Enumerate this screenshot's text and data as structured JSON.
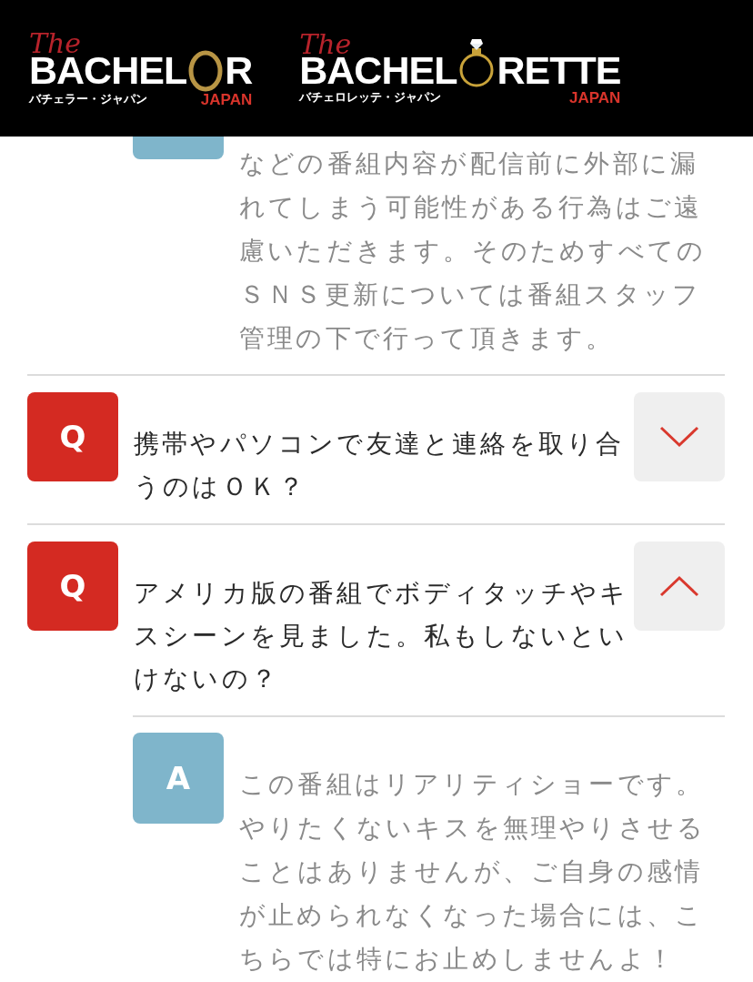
{
  "header": {
    "logos": [
      {
        "script": "The",
        "word_start": "BACHEL",
        "word_end": "R",
        "subtitle": "バチェラー・ジャパン",
        "region": "JAPAN"
      },
      {
        "script": "The",
        "word_start": "BACHEL",
        "word_end": "RETTE",
        "subtitle": "バチェロレッテ・ジャパン",
        "region": "JAPAN"
      }
    ]
  },
  "partial_answer": {
    "text": "などの番組内容が配信前に外部に漏れてしまう可能性がある行為はご遠慮いただきます。そのためすべてのＳＮＳ更新については番組スタッフ管理の下で行って頂きます。"
  },
  "questions": [
    {
      "badge": "Q",
      "text": "携帯やパソコンで友達と連絡を取り合うのはＯＫ？",
      "expanded": false
    },
    {
      "badge": "Q",
      "text": "アメリカ版の番組でボディタッチやキスシーンを見ました。私もしないといけないの？",
      "expanded": true,
      "answer": {
        "badge": "A",
        "text": "この番組はリアリティショーです。やりたくないキスを無理やりさせることはありませんが、ご自身の感情が止められなくなった場合には、こちらでは特にお止めしませんよ！"
      }
    }
  ]
}
